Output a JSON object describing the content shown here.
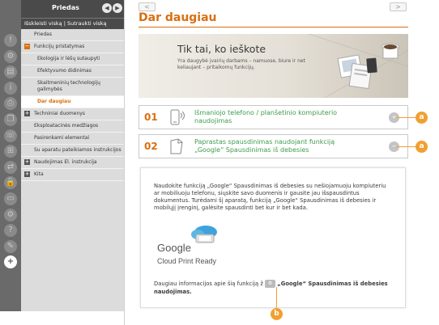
{
  "sidebar": {
    "title": "Priedas",
    "expand_collapse": "Išskleisti viską | Sutraukti viską",
    "items": [
      {
        "label": "Priedas",
        "level": 0,
        "marker": "",
        "active": false
      },
      {
        "label": "Funkcijų pristatymas",
        "level": 0,
        "marker": "−",
        "active": false
      },
      {
        "label": "Ekologija ir lėšų sutaupyti",
        "level": 1,
        "marker": "",
        "active": false
      },
      {
        "label": "Efektyvumo didinimas",
        "level": 1,
        "marker": "",
        "active": false
      },
      {
        "label": "Skaitmeninių technologijų galimybės",
        "level": 1,
        "marker": "",
        "active": false
      },
      {
        "label": "Dar daugiau",
        "level": 1,
        "marker": "",
        "active": true
      },
      {
        "label": "Techniniai duomenys",
        "level": 0,
        "marker": "+",
        "active": false
      },
      {
        "label": "Eksploatacinės medžiagos",
        "level": 0,
        "marker": "",
        "active": false
      },
      {
        "label": "Pasirenkami elementai",
        "level": 0,
        "marker": "",
        "active": false
      },
      {
        "label": "Su aparatu pateikiamos instrukcijos",
        "level": 0,
        "marker": "",
        "active": false
      },
      {
        "label": "Naudojimas El. instrukcija",
        "level": 0,
        "marker": "+",
        "active": false
      },
      {
        "label": "Kita",
        "level": 0,
        "marker": "+",
        "active": false
      }
    ]
  },
  "icon_strip": [
    "warning-icon",
    "settings-icon",
    "paper-icon",
    "info-icon",
    "printer-icon",
    "copy-icon",
    "fax-icon",
    "scan-icon",
    "network-icon",
    "lock-icon",
    "monitor-icon",
    "gear-icon",
    "help-icon",
    "wrench-icon",
    "plus-icon"
  ],
  "header": {
    "page_title": "Dar daugiau",
    "prev_glyph": "<",
    "next_glyph": ">"
  },
  "banner": {
    "title": "Tik tai, ko ieškote",
    "text": "Yra daugybė įvairių darbams – namuose, biure ir net keliaujant – pritaikomų funkcijų."
  },
  "features": [
    {
      "number": "01",
      "text": "Išmaniojo telefono / planšetinio kompiuterio naudojimas",
      "icon": "smartphone-icon",
      "toggle": "+"
    },
    {
      "number": "02",
      "text": "Paprastas spausdinimas naudojant funkciją „Google“ Spausdinimas iš debesies",
      "icon": "document-icon",
      "toggle": "−"
    }
  ],
  "detail": {
    "body": "Naudokite funkciją „Google“ Spausdinimas iš debesies su nešiojamuoju kompiuteriu ar mobiliuoju telefonu, siųskite savo duomenis ir gausite jau išspausdintus dokumentus. Turėdami šį aparatą, funkciją „Google“ Spausdinimas iš debesies ir mobilųjį įrenginį, galėsite spausdinti bet kur ir bet kada.",
    "logo_word": "Google",
    "logo_sub": "Cloud Print Ready",
    "link_prefix": "Daugiau informacijos apie šią funkciją ž",
    "link_bold": "„Google“ Spausdinimas iš debesies naudojimas."
  },
  "callouts": [
    "a",
    "a",
    "b"
  ],
  "colors": {
    "accent": "#d96f10",
    "green_text": "#3e9c4c",
    "callout": "#f0a030",
    "sidebar_bg": "#dcdcdc",
    "header_bg": "#4a4a4a"
  }
}
